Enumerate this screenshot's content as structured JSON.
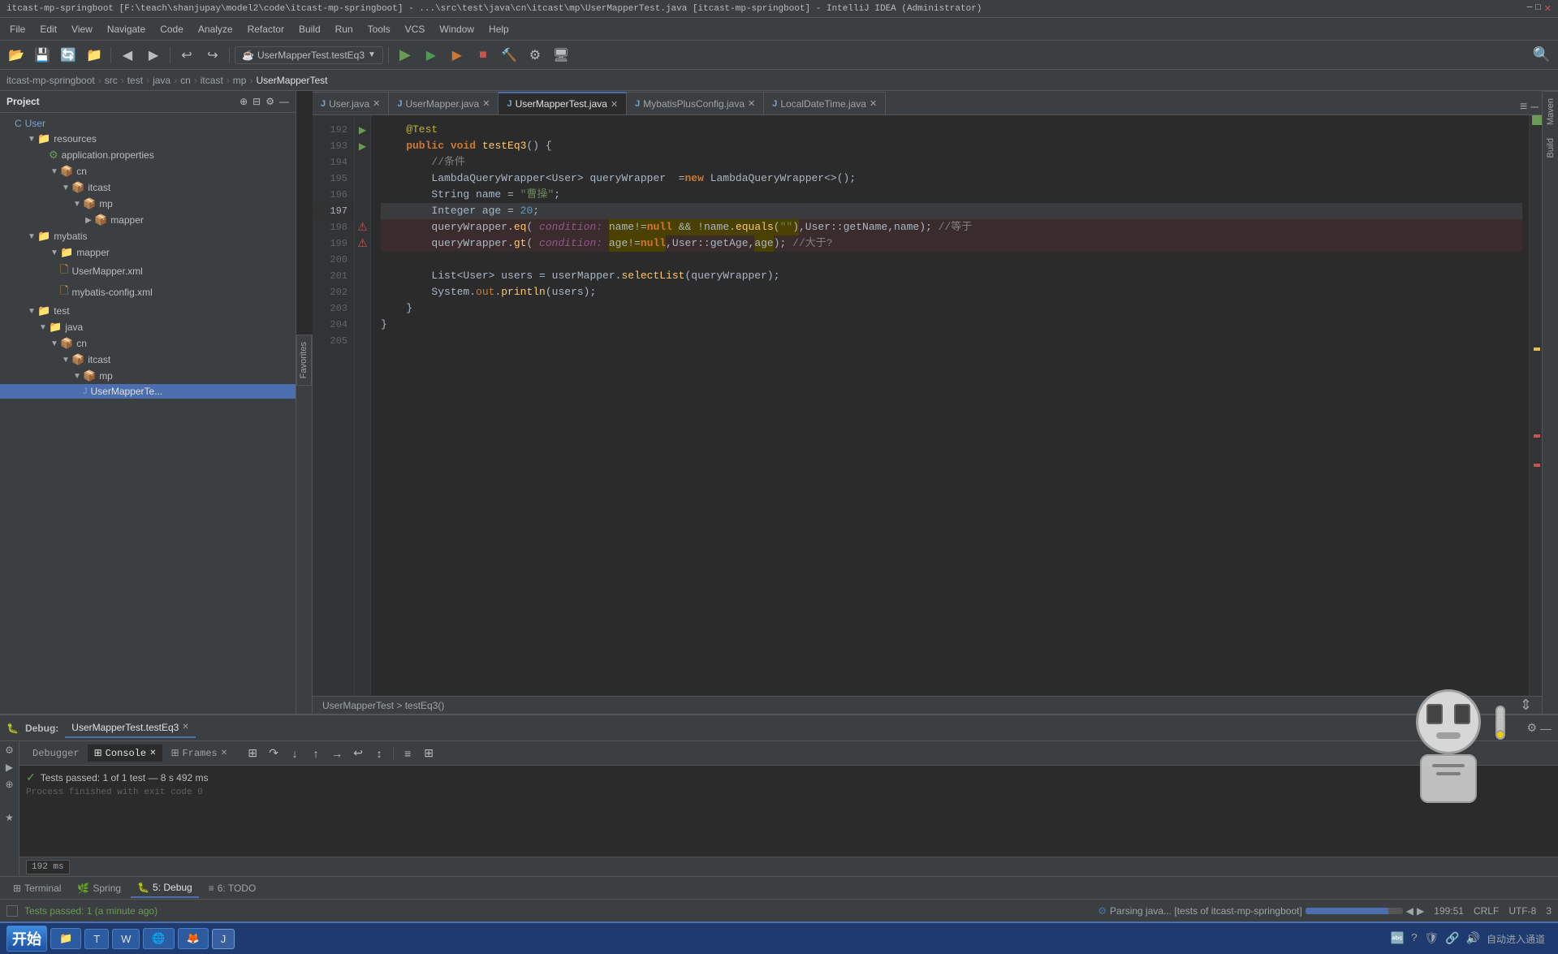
{
  "titleBar": {
    "text": "itcast-mp-springboot [F:\\teach\\shanjupay\\model2\\code\\itcast-mp-springboot] - ...\\src\\test\\java\\cn\\itcast\\mp\\UserMapperTest.java [itcast-mp-springboot] - IntelliJ IDEA (Administrator)"
  },
  "menuBar": {
    "items": [
      "File",
      "Edit",
      "View",
      "Navigate",
      "Code",
      "Analyze",
      "Refactor",
      "Build",
      "Run",
      "Tools",
      "VCS",
      "Window",
      "Help"
    ]
  },
  "toolbar": {
    "runConfig": "UserMapperTest.testEq3",
    "buttons": [
      "folder-open",
      "save",
      "sync",
      "folder",
      "back",
      "forward",
      "undo",
      "redo"
    ]
  },
  "breadcrumb": {
    "items": [
      "itcast-mp-springboot",
      "src",
      "test",
      "java",
      "cn",
      "itcast",
      "mp",
      "UserMapperTest"
    ]
  },
  "tabs": [
    {
      "label": "User.java",
      "icon": "J",
      "active": false,
      "modified": false
    },
    {
      "label": "UserMapper.java",
      "icon": "J",
      "active": false,
      "modified": false
    },
    {
      "label": "UserMapperTest.java",
      "icon": "J",
      "active": true,
      "modified": false
    },
    {
      "label": "MybatisPlusConfig.java",
      "icon": "J",
      "active": false,
      "modified": false
    },
    {
      "label": "LocalDateTime.java",
      "icon": "J",
      "active": false,
      "modified": false
    }
  ],
  "sidebar": {
    "title": "Project",
    "tree": [
      {
        "indent": 0,
        "type": "class",
        "label": "User",
        "icon": "C"
      },
      {
        "indent": 1,
        "type": "folder",
        "label": "resources",
        "icon": "📁",
        "expanded": true
      },
      {
        "indent": 2,
        "type": "file",
        "label": "application.properties",
        "icon": "⚙"
      },
      {
        "indent": 2,
        "type": "folder",
        "label": "cn",
        "icon": "📦",
        "expanded": true
      },
      {
        "indent": 3,
        "type": "folder",
        "label": "itcast",
        "icon": "📦",
        "expanded": true
      },
      {
        "indent": 4,
        "type": "folder",
        "label": "mp",
        "icon": "📦",
        "expanded": true
      },
      {
        "indent": 5,
        "type": "folder",
        "label": "mapper",
        "icon": "📦"
      },
      {
        "indent": 1,
        "type": "folder",
        "label": "mybatis",
        "icon": "📁",
        "expanded": true
      },
      {
        "indent": 2,
        "type": "folder",
        "label": "mapper",
        "icon": "📁",
        "expanded": true
      },
      {
        "indent": 3,
        "type": "xml",
        "label": "UserMapper.xml",
        "icon": "X"
      },
      {
        "indent": 3,
        "type": "xml",
        "label": "mybatis-config.xml",
        "icon": "X"
      },
      {
        "indent": 1,
        "type": "folder",
        "label": "test",
        "icon": "📁",
        "expanded": true
      },
      {
        "indent": 2,
        "type": "folder",
        "label": "java",
        "icon": "📁",
        "expanded": true
      },
      {
        "indent": 3,
        "type": "folder",
        "label": "cn",
        "icon": "📦",
        "expanded": true
      },
      {
        "indent": 4,
        "type": "folder",
        "label": "itcast",
        "icon": "📦",
        "expanded": true
      },
      {
        "indent": 5,
        "type": "folder",
        "label": "mp",
        "icon": "📦",
        "expanded": true
      },
      {
        "indent": 6,
        "type": "java",
        "label": "UserMapperTe...",
        "icon": "J",
        "selected": true
      }
    ]
  },
  "codeLines": [
    {
      "num": 192,
      "content": "    @Test",
      "type": "annotation"
    },
    {
      "num": 193,
      "content": "    public void testEq3() {",
      "type": "code"
    },
    {
      "num": 194,
      "content": "        //条件",
      "type": "comment"
    },
    {
      "num": 195,
      "content": "        LambdaQueryWrapper<User> queryWrapper  =new LambdaQueryWrapper<>();",
      "type": "code"
    },
    {
      "num": 196,
      "content": "        String name = \"曹操\";",
      "type": "code"
    },
    {
      "num": 197,
      "content": "        Integer age = 20;",
      "type": "code"
    },
    {
      "num": 198,
      "content": "        queryWrapper.eq( condition: name!=null && !name.equals(\"\"),User::getName,name); //等于",
      "type": "code",
      "error": true
    },
    {
      "num": 199,
      "content": "        queryWrapper.gt( condition: age!=null,User::getAge,age); //大于?",
      "type": "code",
      "error": true
    },
    {
      "num": 200,
      "content": "",
      "type": "blank"
    },
    {
      "num": 201,
      "content": "        List<User> users = userMapper.selectList(queryWrapper);",
      "type": "code"
    },
    {
      "num": 202,
      "content": "        System.out.println(users);",
      "type": "code"
    },
    {
      "num": 203,
      "content": "    }",
      "type": "code"
    },
    {
      "num": 204,
      "content": "}",
      "type": "code"
    },
    {
      "num": 205,
      "content": "",
      "type": "blank"
    }
  ],
  "statusLine": {
    "text": "UserMapperTest > testEq3()"
  },
  "debugPanel": {
    "tabLabel": "UserMapperTest.testEq3",
    "tabs": [
      "Debugger",
      "Console",
      "Frames"
    ],
    "testResult": "Tests passed: 1 of 1 test — 8 s 492 ms",
    "processText": "Process finished with exit code 0",
    "timeLabel": "192 ms"
  },
  "bottomTabs": [
    {
      "label": "Terminal",
      "icon": ">_"
    },
    {
      "label": "Spring",
      "icon": "🌿"
    },
    {
      "label": "5: Debug",
      "icon": "🐛"
    },
    {
      "label": "6: TODO",
      "icon": "✓"
    }
  ],
  "statusBar": {
    "testStatus": "Tests passed: 1 (a minute ago)",
    "parsingText": "Parsing java... [tests of itcast-mp-springboot]",
    "position": "199:51",
    "lineEnding": "CRLF",
    "encoding": "UTF-8",
    "indentInfo": "3"
  },
  "rightPanelTabs": [
    "Maven",
    "Build"
  ],
  "leftPanelTabs": [
    "Favorites"
  ],
  "icons": {
    "search": "🔍",
    "settings": "⚙",
    "collapse": "▼",
    "expand": "▶",
    "run": "▶",
    "debug": "🐛",
    "stop": "■",
    "build": "🔨"
  }
}
